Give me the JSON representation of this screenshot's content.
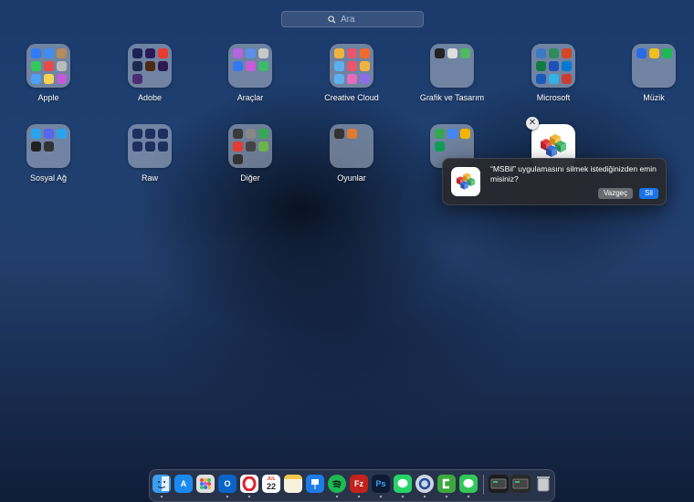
{
  "search": {
    "placeholder": "Ara"
  },
  "folders": [
    {
      "label": "Apple",
      "minis": [
        "#2f7cf6",
        "#3e8ef0",
        "#b38b5d",
        "#34c759",
        "#e84a4a",
        "#bbbbbb",
        "#4ea1f5",
        "#f6d354",
        "#c35bd6"
      ]
    },
    {
      "label": "Adobe",
      "minis": [
        "#1b2155",
        "#2a1a58",
        "#e93b2e",
        "#1b2a4d",
        "#4a2b12",
        "#2d1a4f",
        "#4b2d73"
      ]
    },
    {
      "label": "Araçlar",
      "minis": [
        "#b464e0",
        "#5b8fe8",
        "#c8c8c8",
        "#3478f6",
        "#c95bd8",
        "#3dba6a"
      ]
    },
    {
      "label": "Creative Cloud",
      "minis": [
        "#f0b43c",
        "#e8566a",
        "#f06b2e",
        "#5fb0f0",
        "#e8566a",
        "#f0b43c",
        "#5fb0f0",
        "#e66bbf",
        "#8b6de8"
      ]
    },
    {
      "label": "Grafik ve Tasarım",
      "minis": [
        "#222222",
        "#dddddd",
        "#4dbb5f"
      ]
    },
    {
      "label": "Microsoft",
      "minis": [
        "#3f78c7",
        "#2f8c5a",
        "#d24726",
        "#107c41",
        "#1d4fb8",
        "#0078d4",
        "#185abd",
        "#31b3e8",
        "#cc3c32"
      ]
    },
    {
      "label": "Müzik",
      "minis": [
        "#2a6ce8",
        "#f0c020",
        "#1db954"
      ]
    },
    {
      "label": "Sosyal Ağ",
      "minis": [
        "#2aa3ef",
        "#5865f2",
        "#2aa3ef",
        "#222222",
        "#333333"
      ]
    },
    {
      "label": "Raw",
      "minis": [
        "#1d2f5e",
        "#1d2f5e",
        "#1d2f5e",
        "#1d2f5e",
        "#1d2f5e",
        "#1d2f5e"
      ]
    },
    {
      "label": "Diğer",
      "minis": [
        "#3a3a3a",
        "#888888",
        "#36a853",
        "#e23c33",
        "#444444",
        "#6bb34a",
        "#333333"
      ]
    },
    {
      "label": "Oyunlar",
      "minis": [
        "#333333",
        "#e07a2e"
      ]
    },
    {
      "label": "",
      "minis": [
        "#34a853",
        "#4285f4",
        "#f4b400",
        "#0f9d58"
      ]
    }
  ],
  "app": {
    "name": "MSBil"
  },
  "dialog": {
    "message": "“MSBil” uygulamasını silmek istediğinizden emin misiniz?",
    "cancel_label": "Vazgeç",
    "delete_label": "Sil"
  },
  "dock": {
    "apps": [
      {
        "name": "finder-icon",
        "color": "#3a9ef0",
        "text": ""
      },
      {
        "name": "app-store-icon",
        "color": "#1b8af0",
        "text": "A"
      },
      {
        "name": "launchpad-icon",
        "color": "#e0e0e0",
        "text": ""
      },
      {
        "name": "outlook-icon",
        "color": "#0a64c8",
        "text": "O"
      },
      {
        "name": "opera-icon",
        "color": "#ffffff",
        "text": ""
      },
      {
        "name": "calendar-icon",
        "color": "#ffffff",
        "text": "22"
      },
      {
        "name": "notes-icon",
        "color": "#f7f2dc",
        "text": ""
      },
      {
        "name": "keynote-icon",
        "color": "#1e7ce8",
        "text": ""
      },
      {
        "name": "spotify-icon",
        "color": "#1db954",
        "text": ""
      },
      {
        "name": "filezilla-icon",
        "color": "#c3221b",
        "text": "Fz"
      },
      {
        "name": "photoshop-icon",
        "color": "#0d1a33",
        "text": "Ps"
      },
      {
        "name": "whatsapp-icon",
        "color": "#25d366",
        "text": ""
      },
      {
        "name": "quicktime-icon",
        "color": "#cfd6e0",
        "text": ""
      },
      {
        "name": "camtasia-icon",
        "color": "#3ea83e",
        "text": ""
      },
      {
        "name": "messages-icon",
        "color": "#33c759",
        "text": ""
      },
      {
        "name": "downloads-stack-icon",
        "color": "#1c1c1c",
        "text": ""
      },
      {
        "name": "documents-stack-icon",
        "color": "#2a2a2a",
        "text": ""
      },
      {
        "name": "trash-icon",
        "color": "#9aa0a8",
        "text": ""
      }
    ],
    "calendar_month": "JUL"
  }
}
